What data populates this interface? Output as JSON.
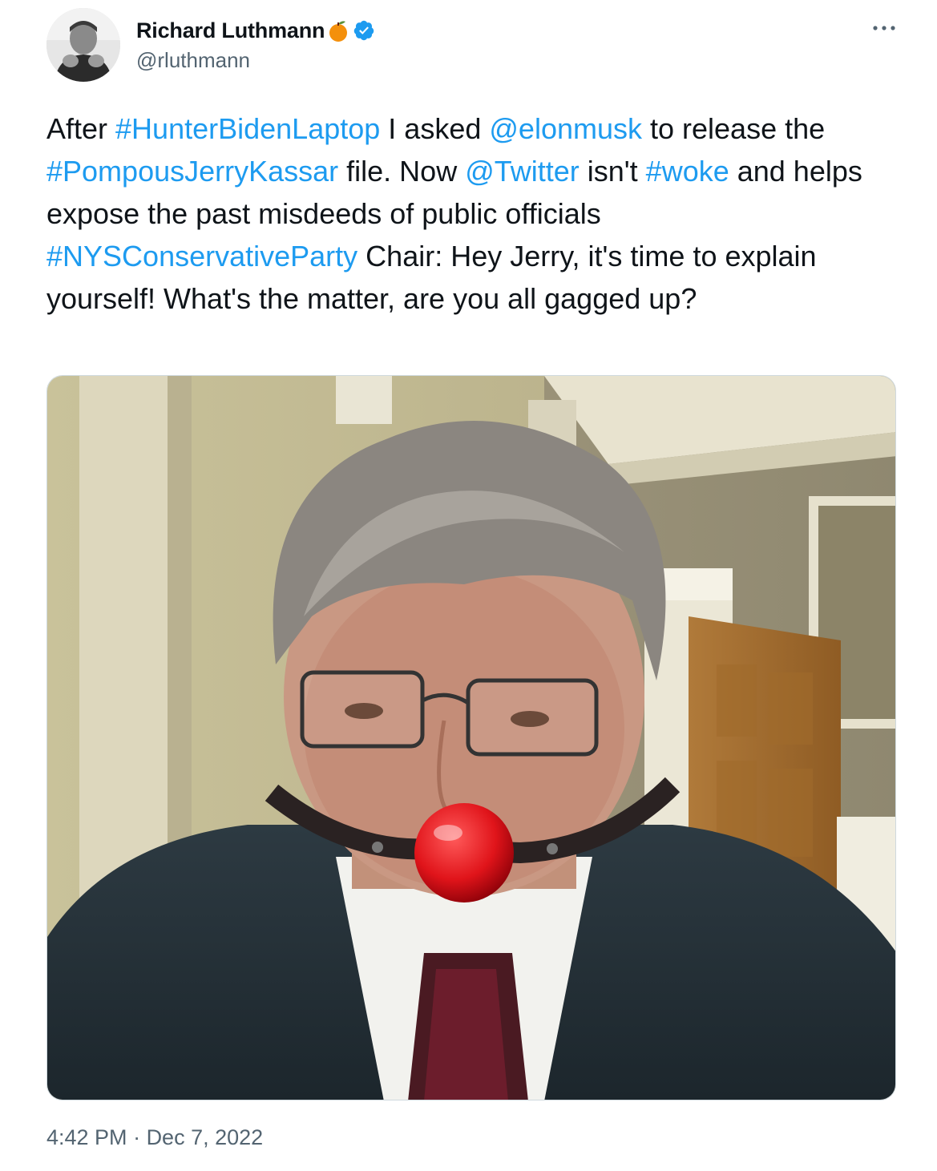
{
  "author": {
    "display_name": "Richard Luthmann",
    "handle": "@rluthmann",
    "avatar_icon": "profile-photo",
    "badge_icon": "orange-emoji",
    "verified_icon": "verified-badge-icon"
  },
  "tweet": {
    "segments": [
      {
        "text": "After ",
        "link": false
      },
      {
        "text": "#HunterBidenLaptop",
        "link": true
      },
      {
        "text": " I asked ",
        "link": false
      },
      {
        "text": "@elonmusk",
        "link": true
      },
      {
        "text": " to release the ",
        "link": false
      },
      {
        "text": "#PompousJerryKassar",
        "link": true
      },
      {
        "text": " file. Now ",
        "link": false
      },
      {
        "text": "@Twitter",
        "link": true
      },
      {
        "text": " isn't ",
        "link": false
      },
      {
        "text": "#woke",
        "link": true
      },
      {
        "text": " and helps expose the past misdeeds of public officials ",
        "link": false
      },
      {
        "text": "#NYSConservativeParty",
        "link": true
      },
      {
        "text": " Chair: Hey Jerry, it's time to explain yourself! What's the matter, are you all gagged up?",
        "link": false
      }
    ]
  },
  "media": {
    "type": "photo"
  },
  "meta": {
    "time": "4:42 PM",
    "separator": " · ",
    "date": "Dec 7, 2022"
  },
  "colors": {
    "link": "#1d9bf0",
    "text": "#0f1419",
    "secondary": "#536471",
    "verified": "#1d9bf0"
  }
}
